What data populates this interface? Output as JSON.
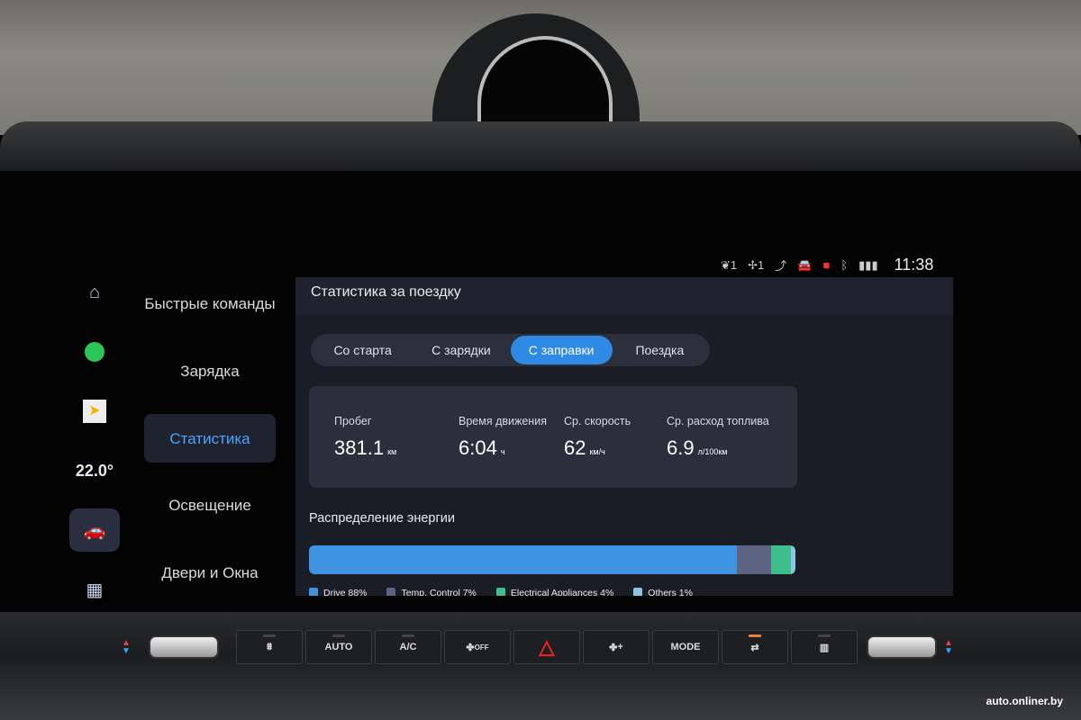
{
  "status_bar": {
    "eco": "1",
    "fan": "1",
    "time": "11:38"
  },
  "dock": {
    "temperature": "22.0°"
  },
  "menu": [
    "Быстрые команды",
    "Зарядка",
    "Статистика",
    "Освещение",
    "Двери и Окна"
  ],
  "panel": {
    "title": "Статистика за поездку",
    "tabs": [
      "Со старта",
      "С зарядки",
      "С заправки",
      "Поездка"
    ],
    "active_tab": 2,
    "stats": [
      {
        "label": "Пробег",
        "value": "381.1",
        "unit": "км"
      },
      {
        "label": "Время движения",
        "value": "6:04",
        "unit": "ч"
      },
      {
        "label": "Ср. скорость",
        "value": "62",
        "unit": "км/ч"
      },
      {
        "label": "Ср. расход топлива",
        "value": "6.9",
        "unit": "л/100км"
      }
    ],
    "energy_title": "Распределение энергии",
    "energy": [
      {
        "label": "Drive 88%",
        "percent": 88,
        "color": "#3f93e0"
      },
      {
        "label": "Temp. Control 7%",
        "percent": 7,
        "color": "#5c6482"
      },
      {
        "label": "Electrical Appliances 4%",
        "percent": 4,
        "color": "#3cbf8a"
      },
      {
        "label": "Others 1%",
        "percent": 1,
        "color": "#8cc4e6"
      }
    ]
  },
  "hw_buttons": [
    "",
    "AUTO",
    "A/C",
    "OFF",
    "",
    "+",
    "MODE",
    "",
    ""
  ],
  "watermark": "auto.onliner.by"
}
